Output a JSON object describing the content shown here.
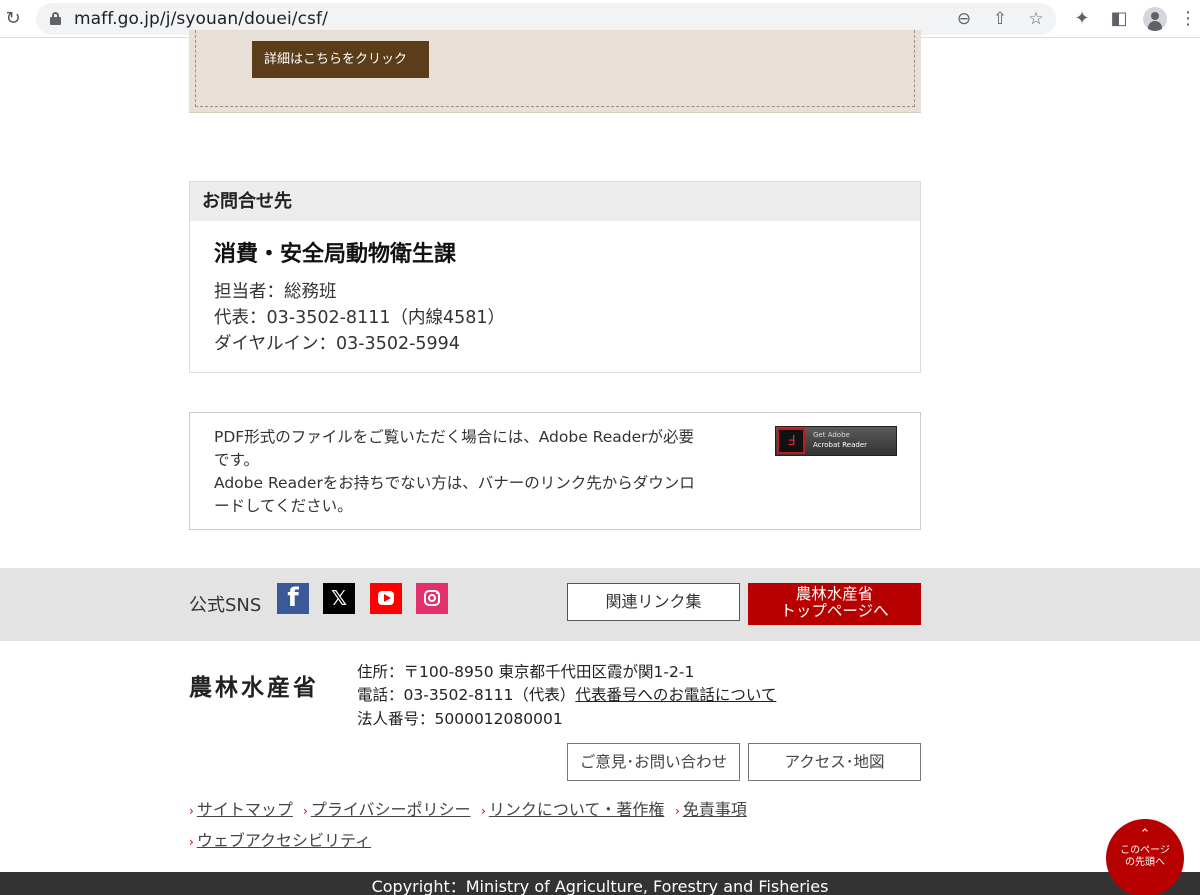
{
  "browser": {
    "url": "maff.go.jp/j/syouan/douei/csf/",
    "reload_icon": "reload-icon",
    "icons": [
      "zoom-icon",
      "share-icon",
      "star-icon",
      "extensions-icon",
      "sidepanel-icon",
      "profile-icon",
      "menu-icon"
    ]
  },
  "detail": {
    "button_label": "詳細はこちらをクリック"
  },
  "contact": {
    "heading": "お問合せ先",
    "department": "消費・安全局動物衛生課",
    "person": "担当者：総務班",
    "main_phone": "代表：03-3502-8111（内線4581）",
    "direct_phone": "ダイヤルイン：03-3502-5994"
  },
  "pdf": {
    "line1": "PDF形式のファイルをご覧いただく場合には、Adobe Readerが必要",
    "line2": "です。",
    "line3": "Adobe Readerをお持ちでない方は、バナーのリンク先からダウンロ",
    "line4": "ードしてください。",
    "banner_line1": "Get Adobe",
    "banner_line2": "Acrobat Reader"
  },
  "sns": {
    "label": "公式SNS",
    "links_button": "関連リンク集",
    "top_button_line1": "農林水産省",
    "top_button_line2": "トップページへ"
  },
  "footer": {
    "logo_text": "農林水産省",
    "address": "住所：〒100-8950 東京都千代田区霞が関1-2-1",
    "phone_prefix": "電話：03-3502-8111（代表）",
    "phone_link": "代表番号へのお電話について",
    "corp_number": "法人番号：5000012080001",
    "opinion_button": "ご意見･お問い合わせ",
    "access_button": "アクセス･地図",
    "links": [
      "サイトマップ",
      "プライバシーポリシー",
      "リンクについて・著作権",
      "免責事項",
      "ウェブアクセシビリティ"
    ],
    "page_top_line1": "このページ",
    "page_top_line2": "の先頭へ",
    "copyright": "Copyright：Ministry of Agriculture, Forestry and Fisheries"
  },
  "colors": {
    "accent_red": "#b70000",
    "detail_brown": "#5b3d1a",
    "tan_bg": "#e8e0d6"
  }
}
